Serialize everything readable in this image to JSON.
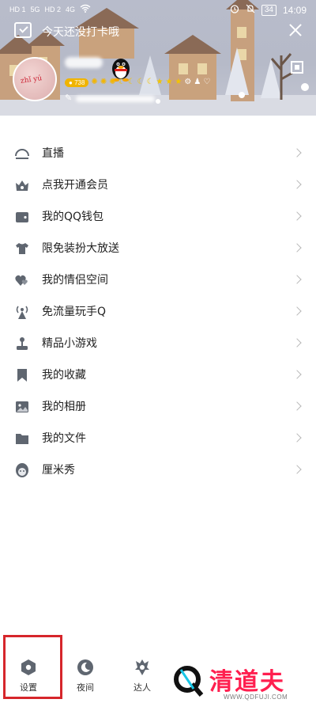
{
  "status_bar": {
    "left_indicators": [
      "HD 1",
      "5G",
      "HD 2",
      "4G"
    ],
    "battery": "34",
    "time": "14:09"
  },
  "header": {
    "checkin_text": "今天还没打卡哦",
    "checkin_icon": "calendar-check-icon",
    "close_icon": "close-icon",
    "qr_icon": "qr-code-icon",
    "badge_number": "738",
    "level_icons": [
      "sun",
      "sun",
      "sun",
      "moon",
      "moon",
      "moon",
      "moon",
      "star",
      "star",
      "star"
    ],
    "avatar_scribble": "zhǐ yú"
  },
  "menu": {
    "items": [
      {
        "label": "直播",
        "icon": "live-icon"
      },
      {
        "label": "点我开通会员",
        "icon": "vip-crown-icon"
      },
      {
        "label": "我的QQ钱包",
        "icon": "wallet-icon"
      },
      {
        "label": "限免装扮大放送",
        "icon": "tshirt-icon"
      },
      {
        "label": "我的情侣空间",
        "icon": "hearts-icon"
      },
      {
        "label": "免流量玩手Q",
        "icon": "signal-tower-icon"
      },
      {
        "label": "精品小游戏",
        "icon": "joystick-icon"
      },
      {
        "label": "我的收藏",
        "icon": "bookmark-icon"
      },
      {
        "label": "我的相册",
        "icon": "photo-icon"
      },
      {
        "label": "我的文件",
        "icon": "folder-icon"
      },
      {
        "label": "厘米秀",
        "icon": "cmshow-avatar-icon"
      }
    ]
  },
  "bottom_bar": {
    "tabs": [
      {
        "label": "设置",
        "icon": "settings-hexagon-icon"
      },
      {
        "label": "夜间",
        "icon": "night-mode-moon-icon"
      },
      {
        "label": "达人",
        "icon": "expert-badge-icon"
      }
    ]
  },
  "watermark": {
    "title": "清道夫",
    "url": "WWW.QDFUJI.COM"
  },
  "colors": {
    "highlight": "#d6262b",
    "icon_gray": "#5f6670",
    "watermark": "#ff1f4f"
  }
}
